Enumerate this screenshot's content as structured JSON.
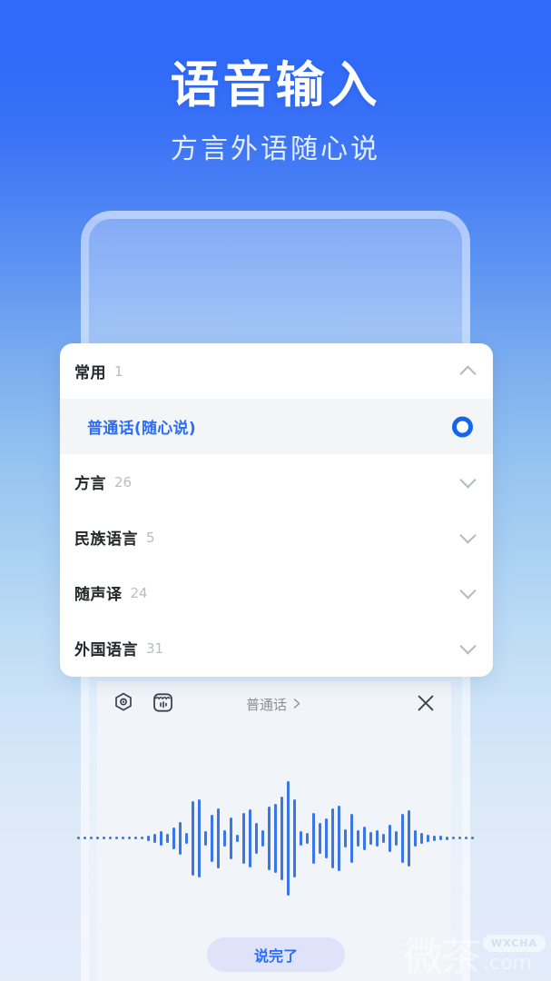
{
  "header": {
    "title": "语音输入",
    "subtitle": "方言外语随心说"
  },
  "colors": {
    "bg_top": "#2f6af8",
    "bg_bottom": "#e3ebf9",
    "accent_blue": "#2b6cf6",
    "wave_blue": "#3b76e8",
    "card_bg": "#ffffff",
    "selected_row_bg": "#f4f5f7",
    "panel_bg": "#f1f4f8",
    "done_btn_bg": "#dfe3fa"
  },
  "language_card": {
    "categories": [
      {
        "name": "常用",
        "count": "1",
        "expanded": true,
        "chevron": "chevron-up-icon"
      },
      {
        "name": "方言",
        "count": "26",
        "expanded": false,
        "chevron": "chevron-down-icon"
      },
      {
        "name": "民族语言",
        "count": "5",
        "expanded": false,
        "chevron": "chevron-down-icon"
      },
      {
        "name": "随声译",
        "count": "24",
        "expanded": false,
        "chevron": "chevron-down-icon"
      },
      {
        "name": "外国语言",
        "count": "31",
        "expanded": false,
        "chevron": "chevron-down-icon"
      }
    ],
    "selected_item": {
      "label": "普通话(随心说)",
      "selected": true,
      "radio_icon": "radio-selected-icon"
    }
  },
  "ime_panel": {
    "toolbar": {
      "settings_icon": "hex-settings-icon",
      "keyboard_icon": "keyboard-voice-icon",
      "language_label": "普通话",
      "language_chevron": "chevron-right-icon",
      "close_icon": "close-icon"
    },
    "waveform": {
      "heights": [
        3,
        3,
        3,
        3,
        3,
        3,
        3,
        3,
        3,
        3,
        3,
        6,
        10,
        16,
        10,
        24,
        36,
        12,
        82,
        86,
        16,
        52,
        66,
        18,
        46,
        8,
        56,
        64,
        34,
        18,
        70,
        76,
        92,
        126,
        86,
        16,
        12,
        56,
        34,
        44,
        66,
        72,
        20,
        54,
        18,
        26,
        14,
        18,
        10,
        30,
        16,
        54,
        62,
        18,
        12,
        8,
        6,
        5,
        4,
        3,
        3,
        3,
        3
      ]
    },
    "done_button": {
      "label": "说完了"
    }
  },
  "watermark": {
    "logo": "微茶",
    "badge": "WXCHA",
    "domain": ".com"
  }
}
